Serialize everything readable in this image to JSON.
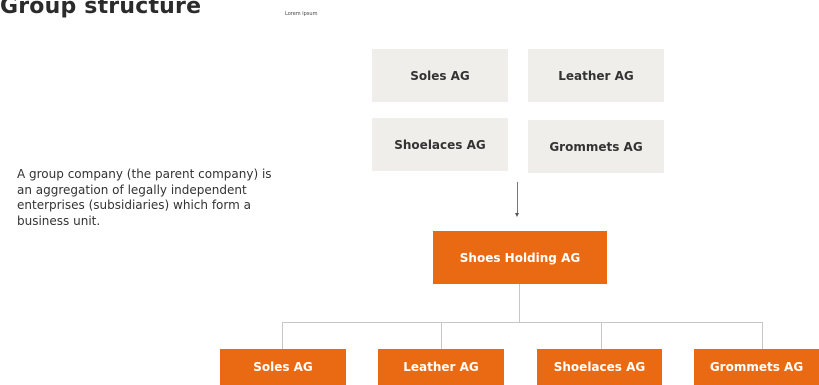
{
  "title": "Group structure",
  "subtitle": "Lorem ipsum",
  "description": "A group company (the parent company) is an aggregation of legally independent enterprises (subsidiaries) which form a business unit.",
  "top_companies": [
    "Soles AG",
    "Leather AG",
    "Shoelaces AG",
    "Grommets AG"
  ],
  "holding": "Shoes Holding AG",
  "subsidiaries": [
    "Soles AG",
    "Leather AG",
    "Shoelaces AG",
    "Grommets AG"
  ],
  "colors": {
    "accent": "#e96a12",
    "grey_box": "#efeeea",
    "connector": "#c6c6c6"
  }
}
